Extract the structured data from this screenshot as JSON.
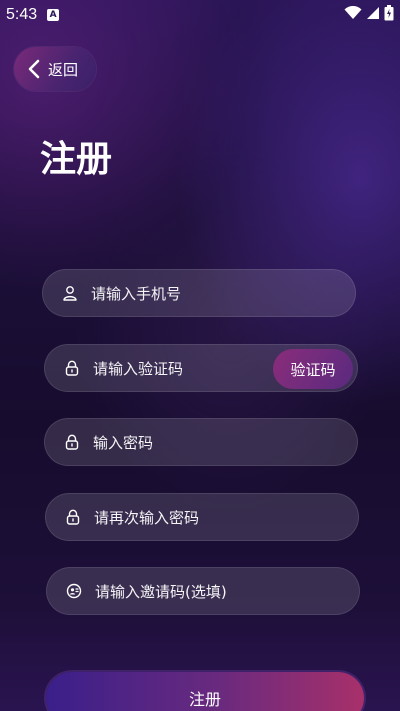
{
  "status_bar": {
    "time": "5:43",
    "notification_icon": "A"
  },
  "back_button": {
    "label": "返回"
  },
  "page": {
    "title": "注册"
  },
  "form": {
    "phone": {
      "placeholder": "请输入手机号",
      "icon": "person-icon"
    },
    "verify_code": {
      "placeholder": "请输入验证码",
      "icon": "lock-icon",
      "button_label": "验证码"
    },
    "password": {
      "placeholder": "输入密码",
      "icon": "lock-icon"
    },
    "confirm_password": {
      "placeholder": "请再次输入密码",
      "icon": "lock-icon"
    },
    "invite_code": {
      "placeholder": "请输入邀请码(选填)",
      "icon": "invite-icon"
    }
  },
  "submit_button": {
    "label": "注册"
  },
  "colors": {
    "background": "#1c0f3a",
    "accent_pink": "#a8306a",
    "accent_purple": "#3a1f8a"
  }
}
